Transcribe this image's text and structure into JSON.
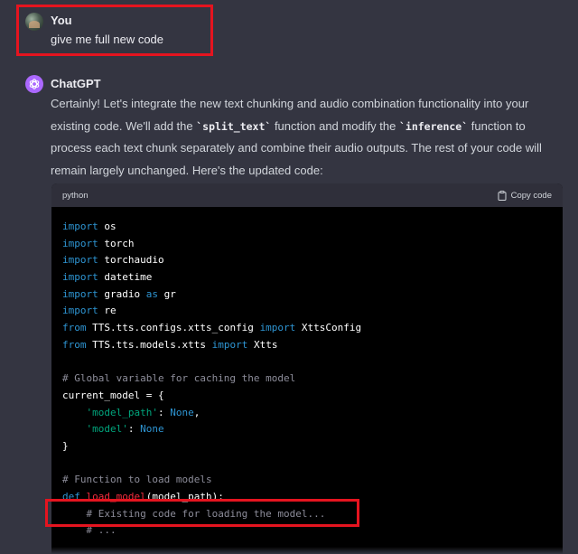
{
  "user_message": {
    "author": "You",
    "text": "give me full new code"
  },
  "assistant_message": {
    "author": "ChatGPT",
    "paragraph": {
      "part1": "Certainly! Let's integrate the new text chunking and audio combination functionality into your existing code. We'll add the ",
      "code1": "`split_text`",
      "part2": " function and modify the ",
      "code2": "`inference`",
      "part3": " function to process each text chunk separately and combine their audio outputs. The rest of your code will remain largely unchanged. Here's the updated code:"
    }
  },
  "code_block": {
    "language": "python",
    "copy_label": "Copy code",
    "lines": [
      [
        {
          "t": "import",
          "c": "kw"
        },
        {
          "t": " os",
          "c": ""
        }
      ],
      [
        {
          "t": "import",
          "c": "kw"
        },
        {
          "t": " torch",
          "c": ""
        }
      ],
      [
        {
          "t": "import",
          "c": "kw"
        },
        {
          "t": " torchaudio",
          "c": ""
        }
      ],
      [
        {
          "t": "import",
          "c": "kw"
        },
        {
          "t": " datetime",
          "c": ""
        }
      ],
      [
        {
          "t": "import",
          "c": "kw"
        },
        {
          "t": " gradio ",
          "c": ""
        },
        {
          "t": "as",
          "c": "kw"
        },
        {
          "t": " gr",
          "c": ""
        }
      ],
      [
        {
          "t": "import",
          "c": "kw"
        },
        {
          "t": " re",
          "c": ""
        }
      ],
      [
        {
          "t": "from",
          "c": "kw"
        },
        {
          "t": " TTS.tts.configs.xtts_config ",
          "c": ""
        },
        {
          "t": "import",
          "c": "kw"
        },
        {
          "t": " XttsConfig",
          "c": ""
        }
      ],
      [
        {
          "t": "from",
          "c": "kw"
        },
        {
          "t": " TTS.tts.models.xtts ",
          "c": ""
        },
        {
          "t": "import",
          "c": "kw"
        },
        {
          "t": " Xtts",
          "c": ""
        }
      ],
      [],
      [
        {
          "t": "# Global variable for caching the model",
          "c": "cm"
        }
      ],
      [
        {
          "t": "current_model = {",
          "c": ""
        }
      ],
      [
        {
          "t": "    ",
          "c": ""
        },
        {
          "t": "'model_path'",
          "c": "str"
        },
        {
          "t": ": ",
          "c": ""
        },
        {
          "t": "None",
          "c": "kw"
        },
        {
          "t": ",",
          "c": ""
        }
      ],
      [
        {
          "t": "    ",
          "c": ""
        },
        {
          "t": "'model'",
          "c": "str"
        },
        {
          "t": ": ",
          "c": ""
        },
        {
          "t": "None",
          "c": "kw"
        }
      ],
      [
        {
          "t": "}",
          "c": ""
        }
      ],
      [],
      [
        {
          "t": "# Function to load models",
          "c": "cm"
        }
      ],
      [
        {
          "t": "def",
          "c": "kw"
        },
        {
          "t": " ",
          "c": ""
        },
        {
          "t": "load_model",
          "c": "fn"
        },
        {
          "t": "(model_path):",
          "c": ""
        }
      ],
      [
        {
          "t": "    ",
          "c": ""
        },
        {
          "t": "# Existing code for loading the model...",
          "c": "cm"
        }
      ],
      [
        {
          "t": "    ",
          "c": ""
        },
        {
          "t": "# ...",
          "c": "cm"
        }
      ]
    ]
  },
  "colors": {
    "background": "#343541",
    "code_background": "#000000",
    "highlight_box": "#e5141f",
    "assistant_avatar": "#ab68ff"
  }
}
